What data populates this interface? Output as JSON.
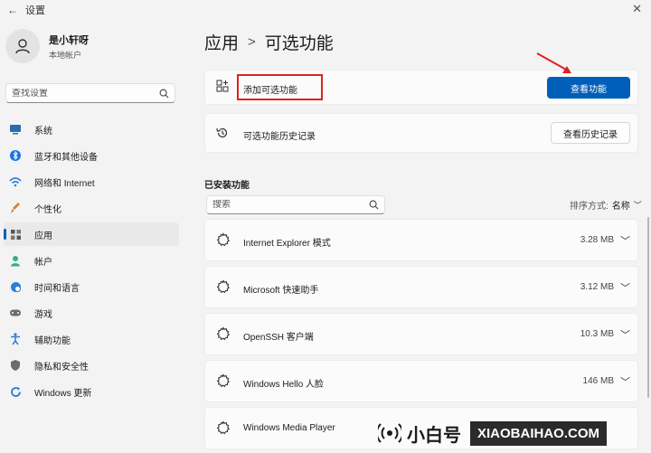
{
  "window": {
    "title": "设置",
    "back_icon": "back-arrow-icon",
    "close_icon": "close-icon"
  },
  "profile": {
    "name": "是小轩呀",
    "account": "本地帐户"
  },
  "sidebar": {
    "search_placeholder": "查找设置",
    "items": [
      {
        "label": "系统",
        "icon": "monitor-icon",
        "color": "#2b6cb0"
      },
      {
        "label": "蓝牙和其他设备",
        "icon": "bluetooth-icon",
        "color": "#1a73e8"
      },
      {
        "label": "网络和 Internet",
        "icon": "wifi-icon",
        "color": "#2a7fd4"
      },
      {
        "label": "个性化",
        "icon": "brush-icon",
        "color": "#d9822b"
      },
      {
        "label": "应用",
        "icon": "apps-icon",
        "color": "#555555",
        "active": true
      },
      {
        "label": "帐户",
        "icon": "person-icon",
        "color": "#2fb37d"
      },
      {
        "label": "时间和语言",
        "icon": "globe-clock-icon",
        "color": "#2a7fd4"
      },
      {
        "label": "游戏",
        "icon": "gamepad-icon",
        "color": "#6b6b6b"
      },
      {
        "label": "辅助功能",
        "icon": "accessibility-icon",
        "color": "#2a7fd4"
      },
      {
        "label": "隐私和安全性",
        "icon": "shield-icon",
        "color": "#6b6b6b"
      },
      {
        "label": "Windows 更新",
        "icon": "update-icon",
        "color": "#2a7fd4"
      }
    ]
  },
  "header": {
    "breadcrumb_parent": "应用",
    "separator": ">",
    "title": "可选功能"
  },
  "add_card": {
    "label": "添加可选功能",
    "button": "查看功能"
  },
  "history_card": {
    "label": "可选功能历史记录",
    "button": "查看历史记录"
  },
  "installed": {
    "section_title": "已安装功能",
    "search_placeholder": "搜索",
    "sort_label": "排序方式:",
    "sort_value": "名称",
    "features": [
      {
        "name": "Internet Explorer 模式",
        "size": "3.28 MB"
      },
      {
        "name": "Microsoft 快速助手",
        "size": "3.12 MB"
      },
      {
        "name": "OpenSSH 客户端",
        "size": "10.3 MB"
      },
      {
        "name": "Windows Hello 人脸",
        "size": "146 MB"
      },
      {
        "name": "Windows Media Player",
        "size": ""
      }
    ]
  },
  "brand": {
    "cn": "小白号",
    "en": "XIAOBAIHAO.COM"
  },
  "colors": {
    "accent": "#005fb8",
    "highlight": "#e02020"
  }
}
